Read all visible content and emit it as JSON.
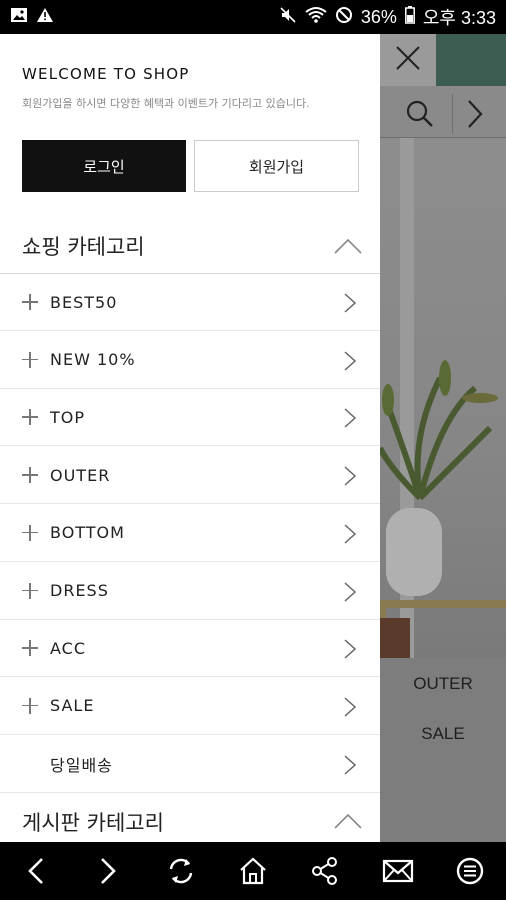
{
  "status_bar": {
    "battery": "36%",
    "time": "오후 3:33"
  },
  "drawer": {
    "welcome_title": "WELCOME TO SHOP",
    "welcome_sub": "회원가입을 하시면 다양한 혜택과 이벤트가 기다리고 있습니다.",
    "login_label": "로그인",
    "join_label": "회원가입",
    "shop_section_title": "쇼핑 카테고리",
    "items": [
      {
        "label": "BEST50",
        "has_plus": true
      },
      {
        "label": "NEW 10%",
        "has_plus": true
      },
      {
        "label": "TOP",
        "has_plus": true
      },
      {
        "label": "OUTER",
        "has_plus": true
      },
      {
        "label": "BOTTOM",
        "has_plus": true
      },
      {
        "label": "DRESS",
        "has_plus": true
      },
      {
        "label": "ACC",
        "has_plus": true
      },
      {
        "label": "SALE",
        "has_plus": true
      },
      {
        "label": "당일배송",
        "has_plus": false
      }
    ],
    "board_section_title": "게시판 카테고리"
  },
  "background": {
    "menu_items": [
      "OUTER",
      "SALE"
    ]
  },
  "icons": {
    "close": "close-icon",
    "search": "search-icon",
    "next": "chevron-right-icon"
  }
}
